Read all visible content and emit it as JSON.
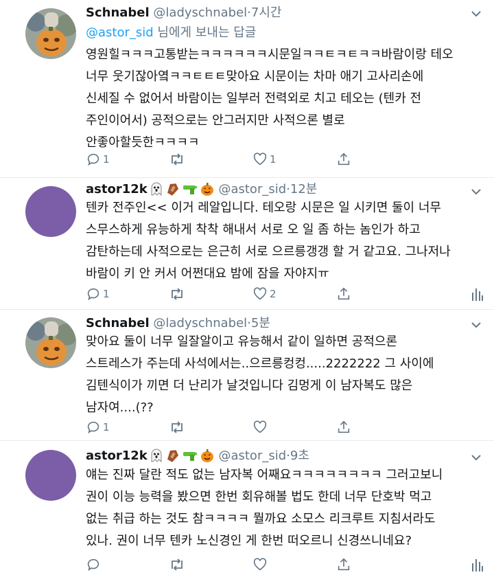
{
  "tweets": [
    {
      "name": "Schnabel",
      "handle": "@ladyschnabel",
      "time": "7시간",
      "reply_to": {
        "handle": "@astor_sid",
        "suffix": "님에게 보내는 답글"
      },
      "lines": [
        "영원힐ㅋㅋㅋ고통받는ㅋㅋㅋㅋㅋㅋ시문일ㅋㅋㅌㅋㅌㅋㅋ바람이랑 테오",
        "너무 웃기잖아옄ㅋㅋㅌㅌㅌ맞아요 시문이는 차마 애기 고사리손에",
        "신세질 수 없어서 바람이는 일부러 전력외로 치고 테오는 (텐카 전",
        "주인이어서) 공적으로는 안그러지만 사적으론 별로",
        "안좋아할듯한ㅋㅋㅋㅋ"
      ],
      "replies": "1",
      "likes": "1"
    },
    {
      "name": "astor12k",
      "handle": "@astor_sid",
      "time": "12분",
      "lines": [
        "텐카 전주인<< 이거 레알입니다. 테오랑 시문은 일 시키면 둘이 너무",
        "스무스하게 유능하게 착착 해내서 서로 오 일 좀 하는 놈인가 하고",
        "감탄하는데 사적으로는 은근히 서로 으르릉갱갱 할 거 같고요. 그나저나",
        "바람이 키 안 커서 어쩐대요 밤에 잠을 자야지ㅠ"
      ],
      "replies": "1",
      "likes": "2"
    },
    {
      "name": "Schnabel",
      "handle": "@ladyschnabel",
      "time": "5분",
      "lines": [
        "맞아요 둘이 너무 일잘알이고 유능해서 같이 일하면 공적으론",
        "스트레스가 주는데 사석에서는..으르릉컹컹.....2222222 그 사이에",
        "김텐식이가 끼면 더 난리가 날것입니다 김멍게 이 남자복도 많은",
        "남자여....(??"
      ],
      "replies": "1",
      "likes": ""
    },
    {
      "name": "astor12k",
      "handle": "@astor_sid",
      "time": "9초",
      "lines": [
        "얘는 진짜 달란 적도 없는 남자복 어째요ㅋㅋㅋㅋㅋㅋㅋㅋ 그러고보니",
        "권이 이능 능력을 봤으면 한번 회유해볼 법도 한데 너무 단호박 먹고",
        "없는 취급 하는 것도 참ㅋㅋㅋㅋ 뭘까요 소모스 리크루트 지침서라도",
        "있나. 권이 너무 텐카 노신경인 게 한번 떠오르니 신경쓰니네요?"
      ],
      "replies": "",
      "likes": ""
    }
  ],
  "separator": "·",
  "emojis": [
    "ghost-emoji",
    "coffin-emoji",
    "water-pistol-emoji",
    "jack-o-lantern-emoji"
  ],
  "colors": {
    "link": "#1da1f2",
    "muted": "#657786",
    "avatar_purple": "#7b5ea7"
  }
}
